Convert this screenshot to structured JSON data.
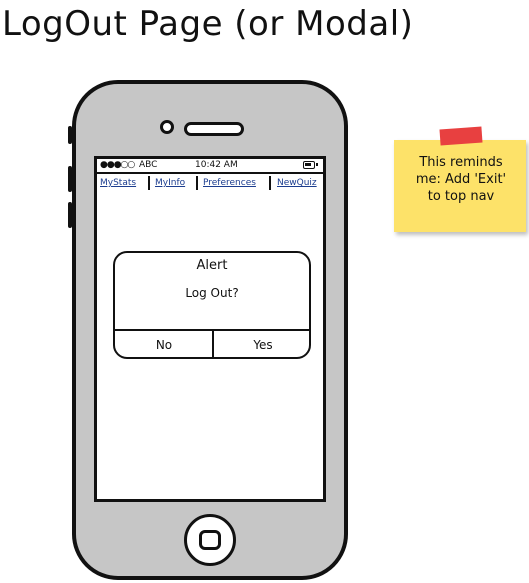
{
  "page": {
    "title": "LogOut Page (or Modal)"
  },
  "status_bar": {
    "signal": "●●●○○",
    "carrier": "ABC",
    "time": "10:42 AM"
  },
  "nav": {
    "items": [
      {
        "label": "MyStats"
      },
      {
        "label": "MyInfo"
      },
      {
        "label": "Preferences"
      },
      {
        "label": "NewQuiz"
      }
    ]
  },
  "alert": {
    "title": "Alert",
    "message": "Log Out?",
    "no_label": "No",
    "yes_label": "Yes"
  },
  "sticky_note": {
    "lines": [
      "This reminds",
      "me: Add 'Exit'",
      "to top nav"
    ]
  },
  "colors": {
    "phone_body": "#c6c6c6",
    "nav_link": "#1c3d8f",
    "sticky_note": "#fde269",
    "sticky_tape": "#e84040"
  }
}
